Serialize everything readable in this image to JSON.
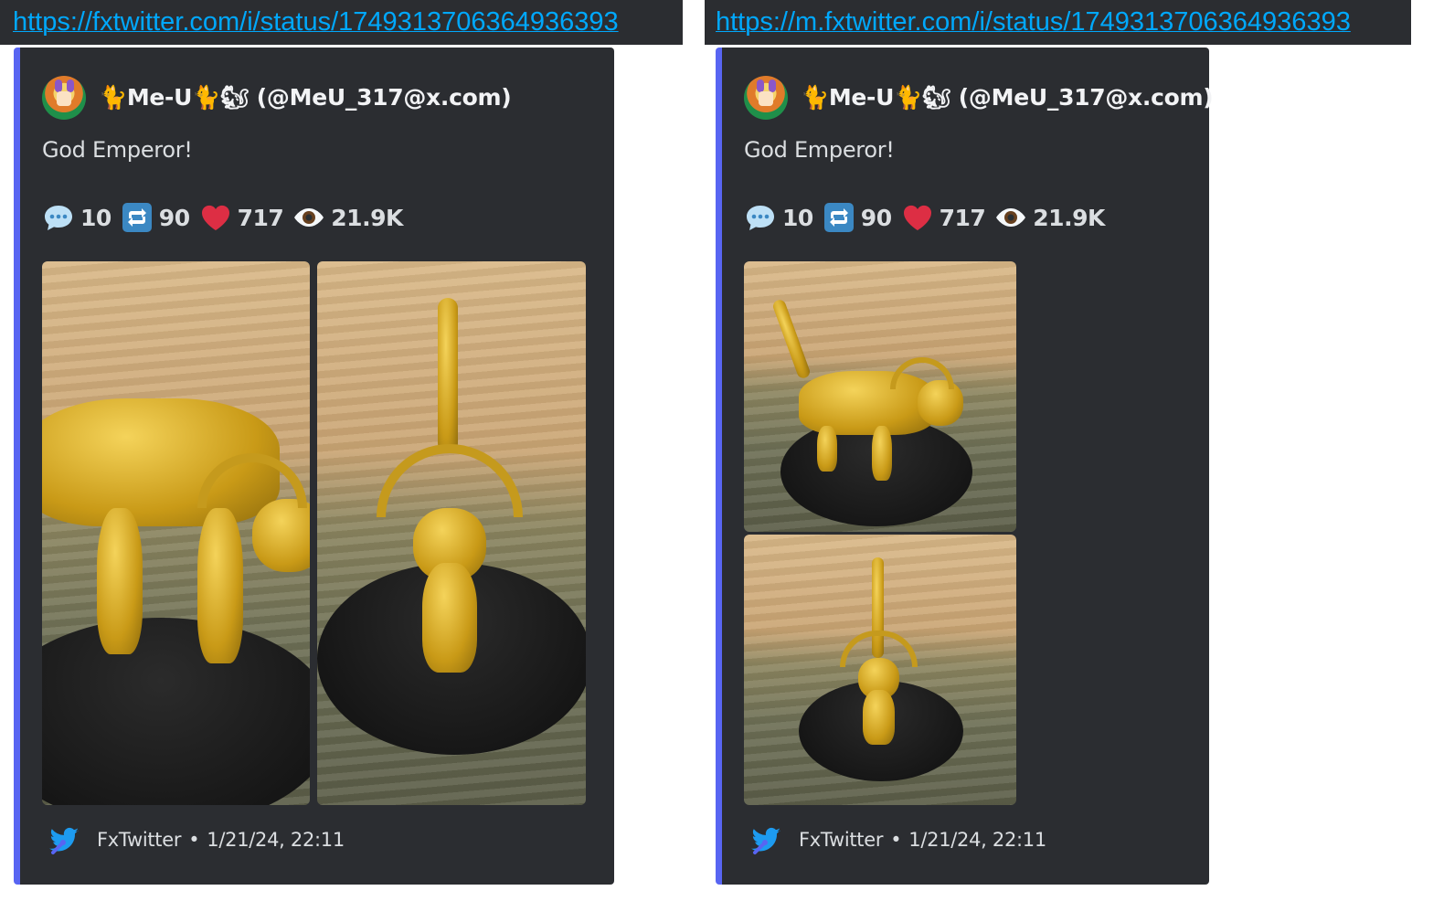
{
  "left": {
    "url": "https://fxtwitter.com/i/status/1749313706364936393"
  },
  "right": {
    "url": "https://m.fxtwitter.com/i/status/1749313706364936393"
  },
  "embed": {
    "author": "🐈Me-U🐈🐿 (@MeU_317@x.com)",
    "text": "God Emperor!",
    "stats": {
      "replies": "10",
      "retweets": "90",
      "likes": "717",
      "views": "21.9K"
    },
    "footer": {
      "provider": "FxTwitter",
      "separator": "•",
      "timestamp": "1/21/24, 22:11"
    }
  },
  "colors": {
    "link": "#00a8fc",
    "embed_bg": "#2b2d31",
    "embed_border": "#5865f2",
    "heart": "#dd2e44",
    "retweet_bg": "#3b88c3"
  }
}
